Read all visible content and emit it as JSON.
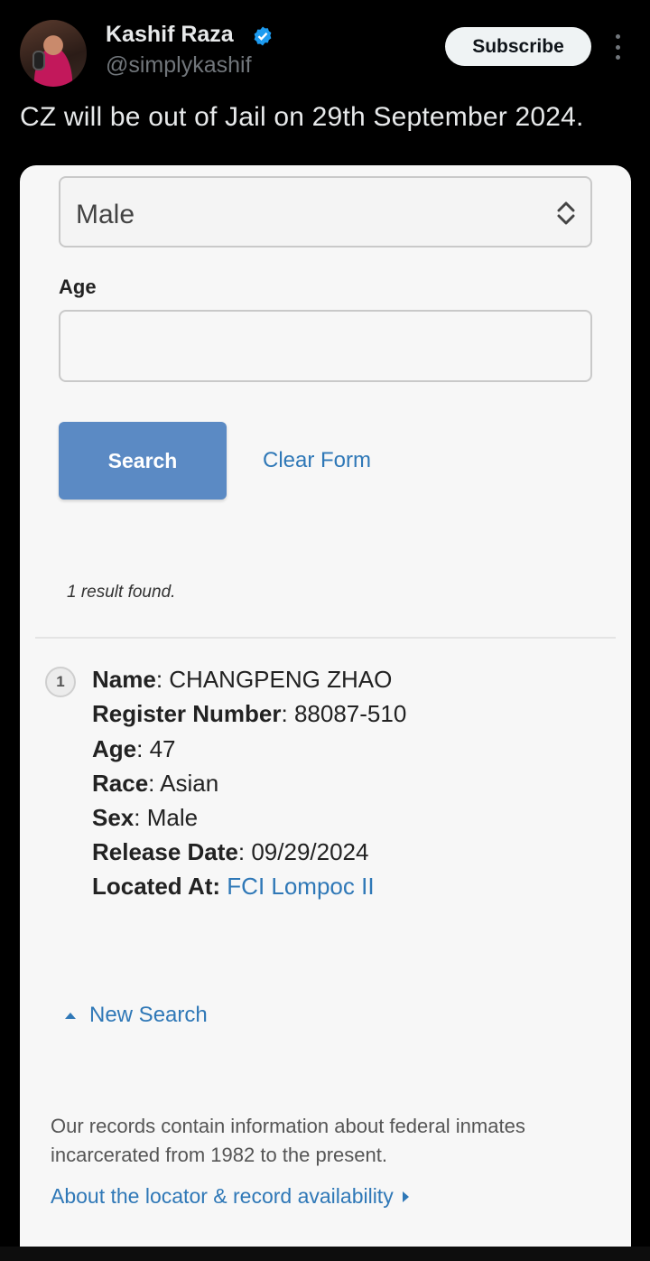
{
  "tweet": {
    "author_name": "Kashif Raza",
    "author_handle": "@simplykashif",
    "subscribe_label": "Subscribe",
    "text": "CZ will be out of Jail on 29th September 2024.",
    "verified_color": "#1d9bf0"
  },
  "form": {
    "sex_select_value": "Male",
    "age_label": "Age",
    "age_value": "",
    "search_label": "Search",
    "clear_label": "Clear Form"
  },
  "results": {
    "count_text": "1 result found.",
    "index": "1",
    "fields": [
      {
        "key": "Name",
        "sep": ": ",
        "value": "CHANGPENG ZHAO"
      },
      {
        "key": "Register Number",
        "sep": ": ",
        "value": "88087-510"
      },
      {
        "key": "Age",
        "sep": ": ",
        "value": "47"
      },
      {
        "key": "Race",
        "sep": ": ",
        "value": "Asian"
      },
      {
        "key": "Sex",
        "sep": ": ",
        "value": "Male"
      },
      {
        "key": "Release Date",
        "sep": ": ",
        "value": "09/29/2024"
      },
      {
        "key": "Located At:",
        "sep": " ",
        "value": "FCI Lompoc II"
      }
    ]
  },
  "footer": {
    "new_search": "New Search",
    "note": "Our records contain information about federal inmates incarcerated from 1982 to the present.",
    "about_link": "About the locator & record availability"
  },
  "colors": {
    "link": "#2f78b7",
    "button": "#5b8ac4"
  }
}
